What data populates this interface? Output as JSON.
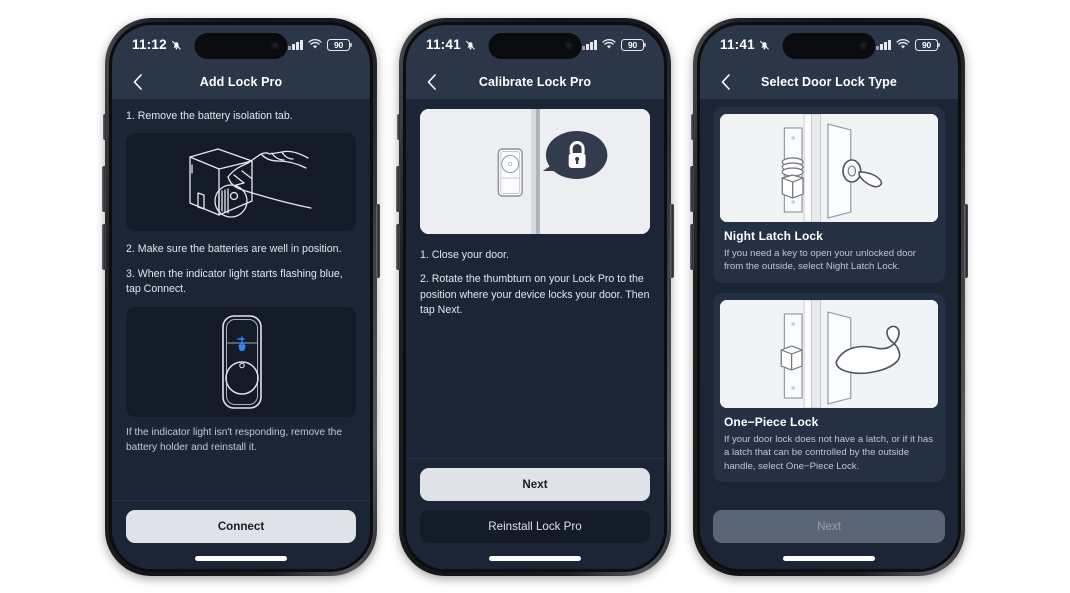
{
  "theme": {
    "bg_page": "#ffffff",
    "screen_header_bg": "#2b3649",
    "screen_body_bg": "#1c2536",
    "illustration_bg": "#131b29",
    "card_bg": "#253044",
    "primary_button_bg": "#dfe3e8",
    "disabled_button_bg": "#5a6577",
    "accent_blue": "#2f86f2",
    "text_primary": "#ffffff",
    "text_secondary": "#c2c8d2"
  },
  "phones": [
    {
      "id": "add-lock-pro",
      "status_bar": {
        "time": "11:12",
        "silent_icon": "bell-off-icon",
        "signal_icon": "cellular-signal-icon",
        "wifi_icon": "wifi-icon",
        "battery_level": "90"
      },
      "nav": {
        "back_icon": "chevron-left-icon",
        "title": "Add Lock Pro"
      },
      "steps": [
        "1. Remove the battery isolation tab.",
        "2. Make sure the batteries are well in position.",
        "3. When the indicator light starts flashing blue, tap Connect."
      ],
      "illustration_1": "hand-removing-battery-tab-illustration",
      "illustration_2": "lock-body-indicator-light-illustration",
      "note": "If the indicator light isn't responding, remove the battery holder and reinstall it.",
      "primary_button": "Connect"
    },
    {
      "id": "calibrate-lock-pro",
      "status_bar": {
        "time": "11:41",
        "silent_icon": "bell-off-icon",
        "signal_icon": "cellular-signal-icon",
        "wifi_icon": "wifi-icon",
        "battery_level": "90"
      },
      "nav": {
        "back_icon": "chevron-left-icon",
        "title": "Calibrate Lock Pro"
      },
      "illustration": "closed-door-with-lock-badge-illustration",
      "steps": [
        "1. Close your door.",
        "2. Rotate the thumbturn on your Lock Pro to the position where your device locks your door. Then tap Next."
      ],
      "primary_button": "Next",
      "secondary_button": "Reinstall Lock Pro"
    },
    {
      "id": "select-door-lock-type",
      "status_bar": {
        "time": "11:41",
        "silent_icon": "bell-off-icon",
        "signal_icon": "cellular-signal-icon",
        "wifi_icon": "wifi-icon",
        "battery_level": "90"
      },
      "nav": {
        "back_icon": "chevron-left-icon",
        "title": "Select Door Lock Type"
      },
      "options": [
        {
          "image": "night-latch-lock-illustration",
          "title": "Night Latch Lock",
          "description": "If you need a key to open your unlocked door from the outside, select Night Latch Lock."
        },
        {
          "image": "one-piece-lock-illustration",
          "title": "One−Piece Lock",
          "description": "If your door lock does not have a latch, or if it has a latch that can be controlled by the outside handle, select One−Piece Lock."
        }
      ],
      "primary_button": "Next",
      "primary_button_disabled": true
    }
  ]
}
